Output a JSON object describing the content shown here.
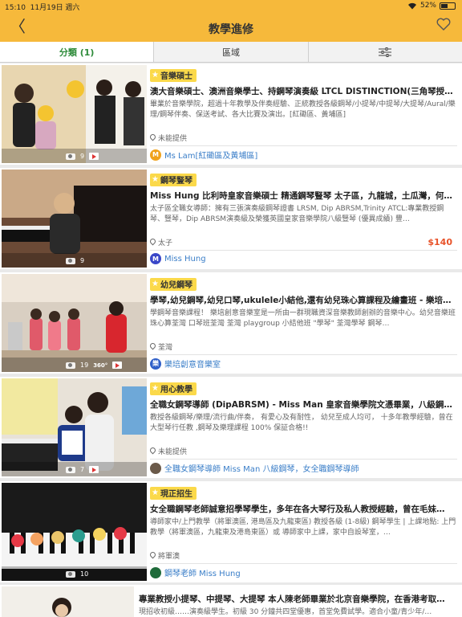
{
  "status": {
    "time": "15:10",
    "date": "11月19日 週六",
    "battery": "52%",
    "battery_level": 0.52
  },
  "header": {
    "title": "教學進修",
    "back_symbol": "〈"
  },
  "tabs": [
    {
      "label": "分類 (1)"
    },
    {
      "label": "區域"
    }
  ],
  "colors": {
    "header": "#f6b93b",
    "tag": "#fbd94a",
    "link": "#3a7ec8",
    "price": "#e8532a",
    "active_tab": "#2e8b3a"
  },
  "listings": [
    {
      "tag": "音樂碩士",
      "title": "澳大音樂碩士、澳洲音樂學士、持鋼琴演奏級 LTCL DISTINCTION(三角琴授…",
      "desc": "畢業於音樂學院，超過十年教學及伴奏經驗、正統教授各級鋼琴/小提琴/中提琴/大提琴/Aural/樂理/鋼琴伴奏、保送考試、各大比賽及演出。[紅磡區、黃埔區]",
      "location": "未能提供",
      "price": "",
      "teacher": "Ms Lam[紅磡區及黃埔區]",
      "avatar": "M",
      "avatar_color": "#f0a21c",
      "photos": "9",
      "video": true,
      "v360": false
    },
    {
      "tag": "鋼琴豎琴",
      "title": "Miss Hung 比利時皇家音樂碩士 精通鋼琴豎琴 太子區，九龍城，土瓜灣，何…",
      "desc": "太子區全職女導師：擁有三張演奏級鋼琴證書 LRSM, Dip ABRSM,Trinity ATCL:專業教授鋼琴、豎琴，Dip ABRSM演奏級及榮獲英國皇家音樂學院八級豎琴 (優異成績) 豐…",
      "location": "太子",
      "price": "$140",
      "teacher": "Miss Hung",
      "avatar": "M",
      "avatar_color": "#3a47c8",
      "photos": "9",
      "video": false,
      "v360": false
    },
    {
      "tag": "幼兒鋼琴",
      "title": "學琴,幼兒鋼琴,幼兒口琴,ukulele小結他,還有幼兒珠心算課程及繪畫班 - 樂培…",
      "desc": "學鋼琴音樂課程！ 樂培創意音樂室是一所由一群現職資深音樂教師創辦的音樂中心。幼兒音樂班 珠心算荃灣 口琴班荃灣 荃灣 playgroup 小結他班 \"學琴\" 荃灣學琴 鋼琴…",
      "location": "荃灣",
      "price": "",
      "teacher": "樂培創意音樂室",
      "avatar": "樂",
      "avatar_color": "#2f5fc8",
      "photos": "19",
      "video": true,
      "v360": true,
      "v360_label": "360°"
    },
    {
      "tag": "用心教學",
      "title": "全職女鋼琴導師 (DipABRSM) - Miss Man 皇家音樂學院文憑畢業，八級鋼琴…",
      "desc": "教授各級鋼琴/樂理/流行曲/伴奏， 有愛心及有耐性， 幼兒至成人均可， 十多年教學經驗，曾在大型琴行任教 ,鋼琴及樂理課程 100% 保証合格!!",
      "location": "未能提供",
      "price": "",
      "teacher": "全職女鋼琴導師 Miss Man 八級鋼琴，女全職鋼琴導師",
      "avatar": "",
      "avatar_color": "#6b5a4a",
      "photos": "7",
      "video": true,
      "v360": false
    },
    {
      "tag": "現正招生",
      "title": "女全職鋼琴老師誠意招學琴學生，多年在各大琴行及私人教授經驗，曾在毛妹…",
      "desc": "導師家中/上門教學（將軍澳區, 港島區及九龍東區) 教授各級 (1-8級) 鋼琴學生 | 上課地點: 上門教學（將軍澳區，九龍東及港島東區）或 導師家中上課，家中自設琴室，…",
      "location": "將軍澳",
      "price": "",
      "teacher": "鋼琴老師 Miss Hung",
      "avatar": "",
      "avatar_color": "#1f6b3a",
      "photos": "10",
      "video": false,
      "v360": false
    }
  ],
  "partial_listing": {
    "title": "專業教授小提琴、中提琴、大提琴 本人陳老師畢業於北京音樂學院，在香港考取…",
    "desc": "現招收初級……演奏級學生。初級 30 分鐘共四堂優惠，首堂免費試學。適合小童/青少年/…"
  }
}
